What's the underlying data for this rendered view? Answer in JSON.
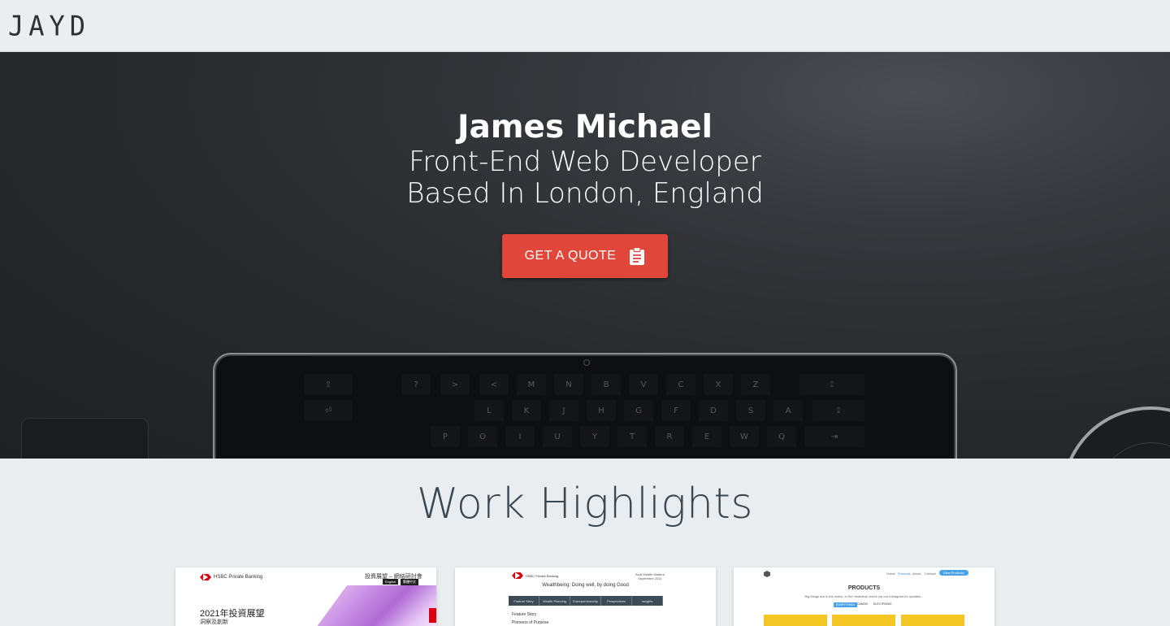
{
  "header": {
    "logo": "JAYD"
  },
  "hero": {
    "name": "James Michael",
    "role": "Front-End Web Developer",
    "location": "Based In London, England",
    "cta_label": "GET A QUOTE",
    "cta_icon": "clipboard-icon",
    "cta_color": "#e0463a"
  },
  "work": {
    "title": "Work Highlights",
    "cards": [
      {
        "brand": "HSBC Private Banking",
        "heading": "2021年投資展望",
        "sub": "洞察及創新",
        "top_right": "投資展望 – 網絡研討會",
        "buttons": [
          "English",
          "繁體中文"
        ]
      },
      {
        "brand": "HSBC Private Banking",
        "heading": "Wealthbeing: Doing well, by doing Good",
        "top_right": "Asia Wealth Matters September 2021",
        "nav": [
          "Feature Story",
          "Wealth Planning",
          "Entrepreneurship",
          "Perspectives",
          "Insights"
        ],
        "lines": [
          "Feature Story",
          "Pioneers of Purpose"
        ]
      },
      {
        "heading": "PRODUCTS",
        "sub": "Big things are in the works, in the meantime check out our Instagram for updates...",
        "nav": [
          "Home",
          "Products",
          "About",
          "Contact"
        ],
        "nav_button": "View Products",
        "tabs": [
          "EVERYTHING",
          "CANON",
          "ELECTRONIC"
        ]
      }
    ]
  }
}
